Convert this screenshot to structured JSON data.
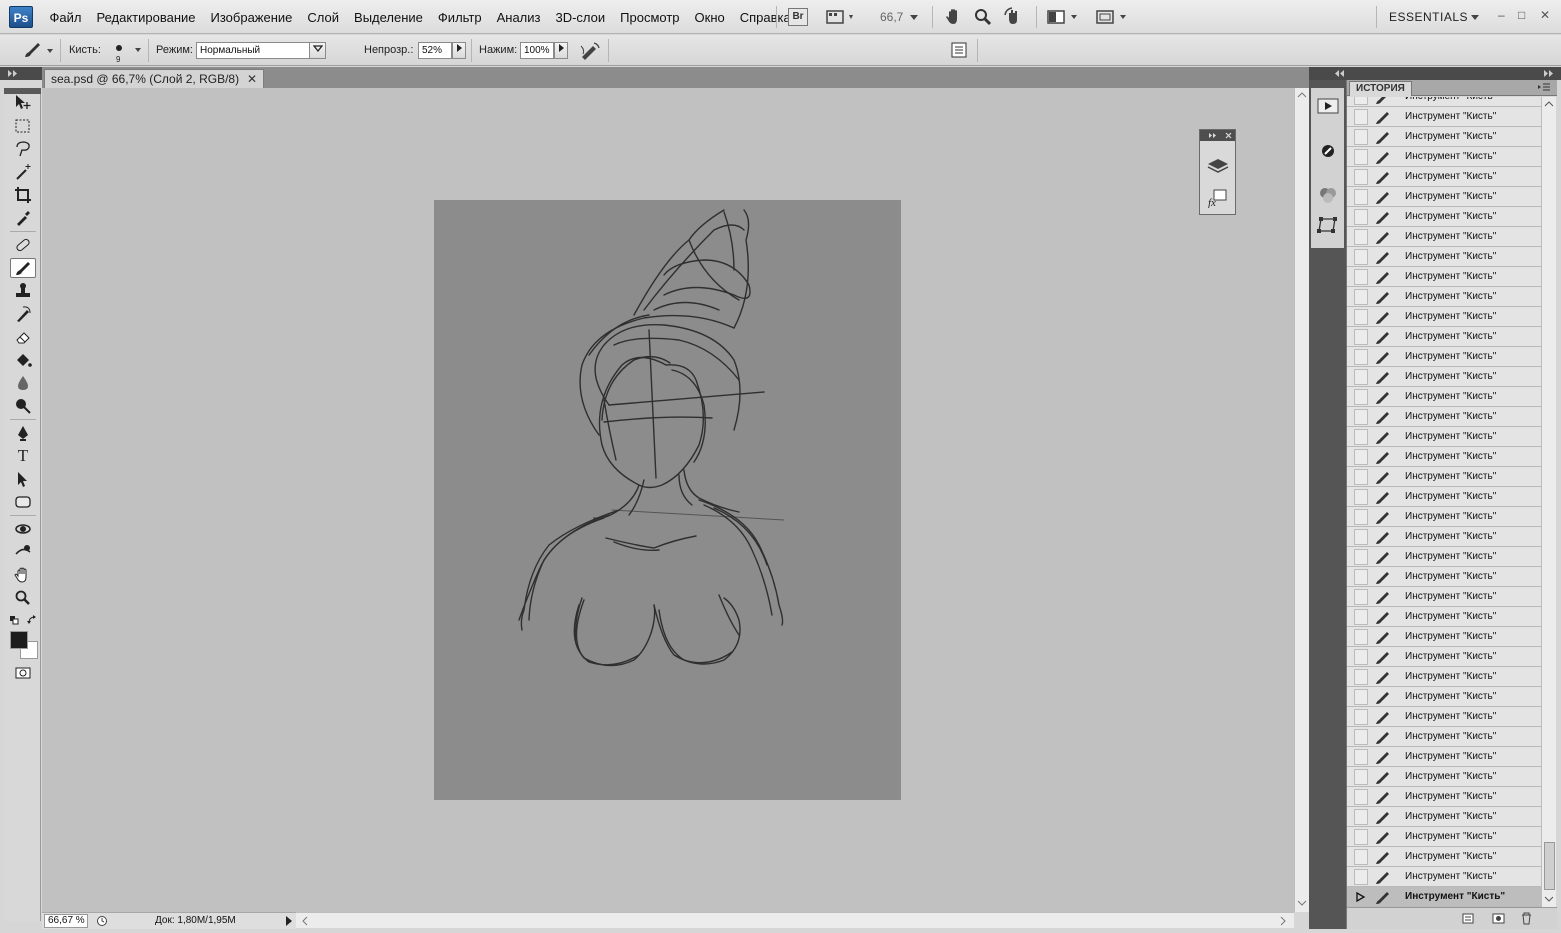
{
  "app": {
    "logo": "Ps"
  },
  "menu": [
    "Файл",
    "Редактирование",
    "Изображение",
    "Слой",
    "Выделение",
    "Фильтр",
    "Анализ",
    "3D-слои",
    "Просмотр",
    "Окно",
    "Справка"
  ],
  "appbar": {
    "bridge": "Br",
    "zoom": "66,7",
    "workspace": "ESSENTIALS"
  },
  "options": {
    "brush_label": "Кисть:",
    "brush_size": "9",
    "mode_label": "Режим:",
    "mode_value": "Нормальный",
    "opacity_label": "Непрозр.:",
    "opacity_value": "52%",
    "flow_label": "Нажим:",
    "flow_value": "100%"
  },
  "document": {
    "tab_title": "sea.psd @ 66,7% (Слой 2, RGB/8)",
    "status_zoom": "66,67 %",
    "status_doc": "Док: 1,80M/1,95M"
  },
  "history": {
    "tab_label": "ИСТОРИЯ",
    "items": [
      "Инструмент \"Кисть\"",
      "Инструмент \"Кисть\"",
      "Инструмент \"Кисть\"",
      "Инструмент \"Кисть\"",
      "Инструмент \"Кисть\"",
      "Инструмент \"Кисть\"",
      "Инструмент \"Кисть\"",
      "Инструмент \"Кисть\"",
      "Инструмент \"Кисть\"",
      "Инструмент \"Кисть\"",
      "Инструмент \"Кисть\"",
      "Инструмент \"Кисть\"",
      "Инструмент \"Кисть\"",
      "Инструмент \"Кисть\"",
      "Инструмент \"Кисть\"",
      "Инструмент \"Кисть\"",
      "Инструмент \"Кисть\"",
      "Инструмент \"Кисть\"",
      "Инструмент \"Кисть\"",
      "Инструмент \"Кисть\"",
      "Инструмент \"Кисть\"",
      "Инструмент \"Кисть\"",
      "Инструмент \"Кисть\"",
      "Инструмент \"Кисть\"",
      "Инструмент \"Кисть\"",
      "Инструмент \"Кисть\"",
      "Инструмент \"Кисть\"",
      "Инструмент \"Кисть\"",
      "Инструмент \"Кисть\"",
      "Инструмент \"Кисть\"",
      "Инструмент \"Кисть\"",
      "Инструмент \"Кисть\"",
      "Инструмент \"Кисть\"",
      "Инструмент \"Кисть\"",
      "Инструмент \"Кисть\"",
      "Инструмент \"Кисть\"",
      "Инструмент \"Кисть\"",
      "Инструмент \"Кисть\"",
      "Инструмент \"Кисть\"",
      "Инструмент \"Кисть\"",
      "Инструмент \"Кисть\""
    ],
    "current_item": "Инструмент \"Кисть\""
  },
  "colors": {
    "foreground": "#1c1c1c",
    "background": "#ffffff",
    "canvas_fill": "#8c8c8c",
    "pasteboard": "#c1c1c1"
  }
}
